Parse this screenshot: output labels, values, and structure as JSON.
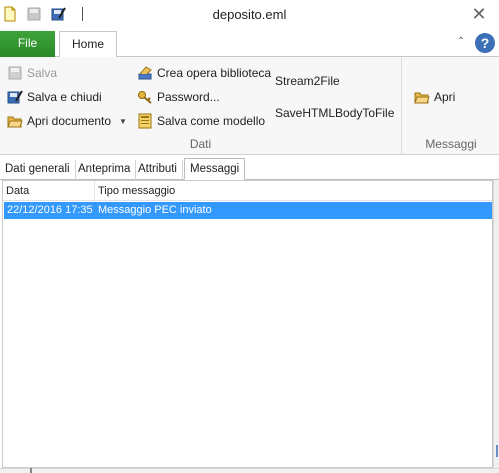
{
  "window": {
    "title": "deposito.eml"
  },
  "tabs": {
    "file": "File",
    "home": "Home"
  },
  "ribbon": {
    "dati": {
      "label": "Dati",
      "salva": "Salva",
      "salva_chiudi": "Salva e chiudi",
      "apri_documento": "Apri documento",
      "crea_opera": "Crea opera biblioteca",
      "password": "Password...",
      "salva_modello": "Salva come modello",
      "stream2file": "Stream2File",
      "savehtml": "SaveHTMLBodyToFile"
    },
    "messaggi": {
      "label": "Messaggi",
      "apri": "Apri"
    }
  },
  "subtabs": [
    "Dati generali",
    "Anteprima",
    "Attributi",
    "Messaggi"
  ],
  "list": {
    "columns": [
      "Data",
      "Tipo messaggio"
    ],
    "rows": [
      {
        "data": "22/12/2016 17:35",
        "tipo": "Messaggio PEC inviato"
      }
    ]
  },
  "colors": {
    "selection": "#3399ff",
    "file_tab": "#2e8f2b",
    "help": "#3b6fb6"
  }
}
